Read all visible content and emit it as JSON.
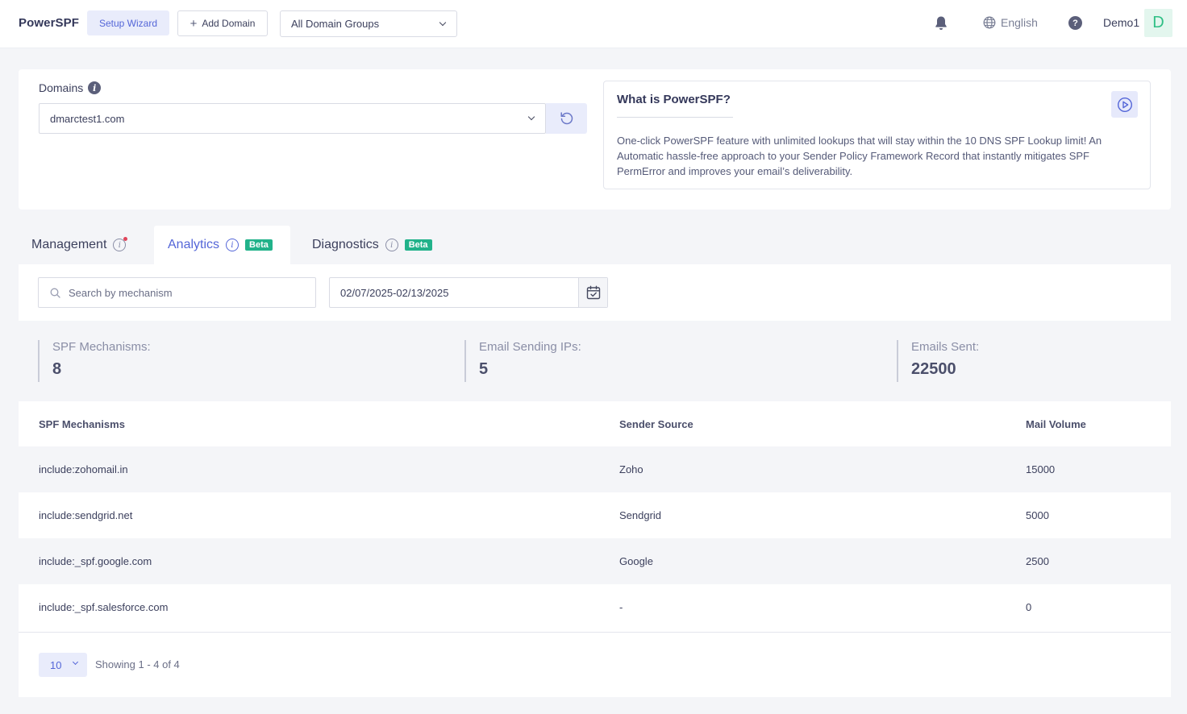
{
  "header": {
    "brand": "PowerSPF",
    "setup_wizard": "Setup Wizard",
    "add_domain": "Add Domain",
    "domain_group": "All Domain Groups",
    "language": "English",
    "username": "Demo1",
    "avatar_letter": "D"
  },
  "domains": {
    "label": "Domains",
    "selected": "dmarctest1.com"
  },
  "info_box": {
    "title": "What is PowerSPF?",
    "text": "One-click PowerSPF feature with unlimited lookups that will stay within the 10 DNS SPF Lookup limit! An Automatic hassle-free approach to your Sender Policy Framework Record that instantly mitigates SPF PermError and improves your email’s deliverability."
  },
  "tabs": [
    {
      "label": "Management"
    },
    {
      "label": "Analytics",
      "badge": "Beta"
    },
    {
      "label": "Diagnostics",
      "badge": "Beta"
    }
  ],
  "filters": {
    "search_placeholder": "Search by mechanism",
    "date_range": "02/07/2025-02/13/2025"
  },
  "stats": [
    {
      "label": "SPF Mechanisms:",
      "value": "8"
    },
    {
      "label": "Email Sending IPs:",
      "value": "5"
    },
    {
      "label": "Emails Sent:",
      "value": "22500"
    }
  ],
  "table": {
    "headers": [
      "SPF Mechanisms",
      "Sender Source",
      "Mail Volume"
    ],
    "rows": [
      {
        "mechanism": "include:zohomail.in",
        "source": "Zoho",
        "volume": "15000"
      },
      {
        "mechanism": "include:sendgrid.net",
        "source": "Sendgrid",
        "volume": "5000"
      },
      {
        "mechanism": "include:_spf.google.com",
        "source": "Google",
        "volume": "2500"
      },
      {
        "mechanism": "include:_spf.salesforce.com",
        "source": "-",
        "volume": "0"
      }
    ]
  },
  "pagination": {
    "page_size": "10",
    "showing": "Showing 1 - 4 of 4"
  },
  "colors": {
    "accent": "#5466d8",
    "beta": "#21b28a",
    "avatar": "#2fbf85"
  }
}
